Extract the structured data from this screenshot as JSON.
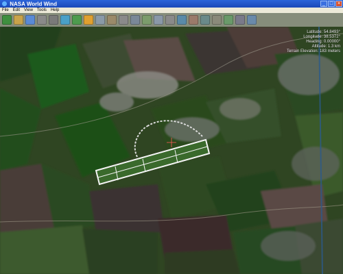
{
  "window": {
    "title": "NASA World Wind",
    "minimize": "_",
    "maximize": "□",
    "close": "×"
  },
  "menu": {
    "items": [
      "File",
      "Edit",
      "View",
      "Tools",
      "Help"
    ]
  },
  "toolbar": {
    "tools": [
      {
        "name": "world-icon",
        "color": "#3f8f3f"
      },
      {
        "name": "layers-icon",
        "color": "#c9a34a"
      },
      {
        "name": "place-names-icon",
        "color": "#5a8ad6"
      },
      {
        "name": "search-icon",
        "color": "#8a8a8a"
      },
      {
        "name": "satellite-icon",
        "color": "#7a7a7a"
      },
      {
        "name": "boundaries-icon",
        "color": "#4aa0c8"
      },
      {
        "name": "landsat-icon",
        "color": "#4e9b4e"
      },
      {
        "name": "globe-color-icon",
        "color": "#e0a030"
      },
      {
        "name": "grid-icon",
        "color": "#8a9aa8"
      },
      {
        "name": "terrain-icon",
        "color": "#9a8a6a"
      },
      {
        "name": "scale-icon",
        "color": "#8a8a8a"
      },
      {
        "name": "photo-icon",
        "color": "#7a8898"
      },
      {
        "name": "map-icon",
        "color": "#7c9c6c"
      },
      {
        "name": "zoom-icon",
        "color": "#8a98a8"
      },
      {
        "name": "measure-icon",
        "color": "#8a8a8a"
      },
      {
        "name": "compass-icon",
        "color": "#5a8aa8"
      },
      {
        "name": "chart-icon",
        "color": "#9a7a6a"
      },
      {
        "name": "info-icon",
        "color": "#6a8a8a"
      },
      {
        "name": "clock-icon",
        "color": "#8a8a7a"
      },
      {
        "name": "add-layer-icon",
        "color": "#6a9a6a"
      },
      {
        "name": "settings-icon",
        "color": "#7a7a8a"
      },
      {
        "name": "help-icon",
        "color": "#6a8aaa"
      }
    ]
  },
  "readout": {
    "latitude": "Latitude: 54.8493°",
    "longitude": "Longitude: 38.5372°",
    "heading": "Heading: 0.00000°",
    "altitude": "Altitude: 1.3 km",
    "elevation": "Terrain Elevation: 183 meters"
  }
}
